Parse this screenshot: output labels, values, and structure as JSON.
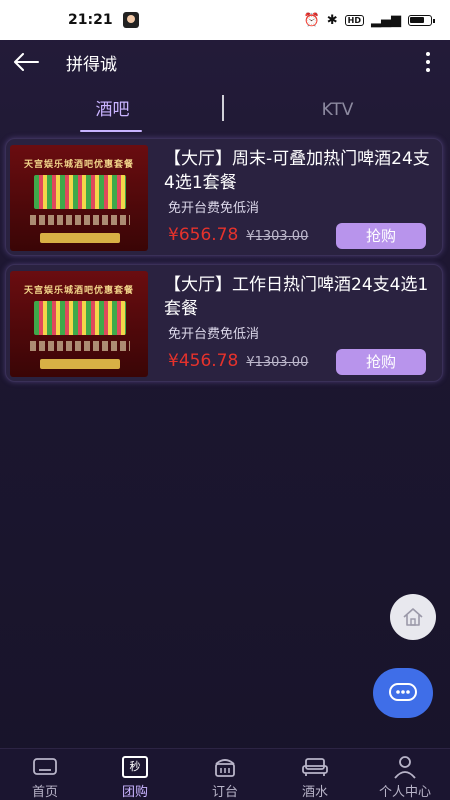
{
  "status_bar": {
    "time": "21:21",
    "icons": [
      "alarm-icon",
      "bluetooth-icon",
      "hd-icon",
      "signal-icon",
      "battery-icon"
    ],
    "hd_label": "HD"
  },
  "header": {
    "title": "拼得诚",
    "back_icon": "arrow-left-icon",
    "more_icon": "more-vertical-icon"
  },
  "tabs": [
    {
      "label": "酒吧",
      "active": true
    },
    {
      "label": "KTV",
      "active": false
    }
  ],
  "deals": [
    {
      "title": "【大厅】周末-可叠加热门啤酒24支4选1套餐",
      "subtitle": "免开台费免低消",
      "price": "¥656.78",
      "original_price": "¥1303.00",
      "button_label": "抢购",
      "image_title": "天宫娱乐城酒吧优惠套餐"
    },
    {
      "title": "【大厅】工作日热门啤酒24支4选1套餐",
      "subtitle": "免开台费免低消",
      "price": "¥456.78",
      "original_price": "¥1303.00",
      "button_label": "抢购",
      "image_title": "天宫娱乐城酒吧优惠套餐"
    }
  ],
  "floating": {
    "home_icon": "home-icon",
    "chat_icon": "chat-bubble-icon"
  },
  "bottom_nav": [
    {
      "label": "首页",
      "icon": "home-tv-icon",
      "active": false
    },
    {
      "label": "团购",
      "icon": "miao-tag-icon",
      "icon_text": "秒",
      "active": true
    },
    {
      "label": "订台",
      "icon": "reserve-icon",
      "active": false
    },
    {
      "label": "酒水",
      "icon": "sofa-icon",
      "active": false
    },
    {
      "label": "个人中心",
      "icon": "person-icon",
      "active": false
    }
  ],
  "colors": {
    "accent": "#c9b4ff",
    "price_red": "#e5322c",
    "buy_button": "#b894ec",
    "chat_button": "#3f6ee8"
  }
}
